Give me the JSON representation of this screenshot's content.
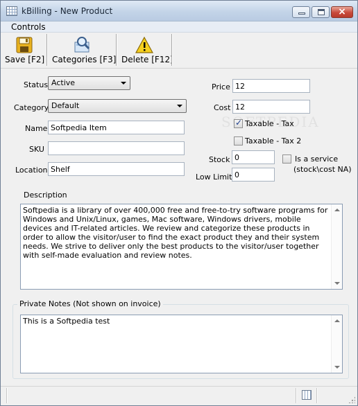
{
  "window": {
    "title": "kBilling - New Product",
    "close_glyph": "×"
  },
  "menu": {
    "controls": "Controls"
  },
  "toolbar": {
    "save": "Save [F2]",
    "categories": "Categories [F3]",
    "delete": "Delete [F12]"
  },
  "form": {
    "status_label": "Status",
    "status_value": "Active",
    "category_label": "Category",
    "category_value": "Default",
    "name_label": "Name",
    "name_value": "Softpedia Item",
    "sku_label": "SKU",
    "sku_value": "",
    "location_label": "Location",
    "location_value": "Shelf",
    "price_label": "Price",
    "price_value": "12",
    "cost_label": "Cost",
    "cost_value": "12",
    "taxable_tax_label": "Taxable - Tax",
    "taxable_tax_checked": true,
    "taxable_tax2_label": "Taxable - Tax 2",
    "taxable_tax2_checked": false,
    "stock_label": "Stock",
    "stock_value": "0",
    "low_limit_label": "Low Limit",
    "low_limit_value": "0",
    "is_service_label": "Is a service",
    "is_service_note": "(stock\\cost NA)",
    "is_service_checked": false
  },
  "description": {
    "label": "Description",
    "text": "Softpedia is a library of over 400,000 free and free-to-try software programs for Windows and Unix/Linux, games, Mac software, Windows drivers, mobile devices and IT-related articles. We review and categorize these products in order to allow the visitor/user to find the exact product they and their system needs. We strive to deliver only the best products to the visitor/user together with self-made evaluation and review notes."
  },
  "private_notes": {
    "label": "Private Notes (Not shown on invoice)",
    "text": "This is a Softpedia test"
  },
  "watermark": "SOFTPEDIA",
  "colors": {
    "title_bar": "#c3d4e8",
    "close_button": "#c8493a",
    "window_bg": "#f0f0f0"
  }
}
